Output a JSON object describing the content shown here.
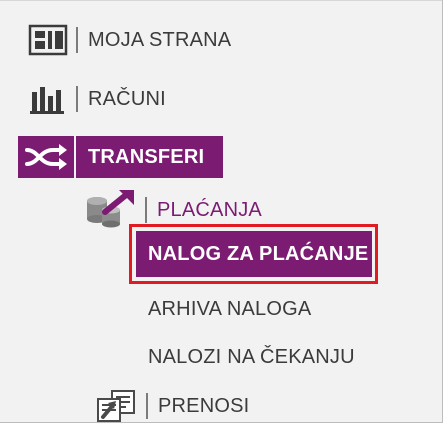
{
  "menu": {
    "items": [
      {
        "label": "MOJA STRANA",
        "icon": "dashboard-icon",
        "active": false
      },
      {
        "label": "RAČUNI",
        "icon": "bar-chart-icon",
        "active": false
      },
      {
        "label": "TRANSFERI",
        "icon": "shuffle-icon",
        "active": true
      }
    ],
    "submenu": {
      "header": {
        "label": "PLAĆANJA",
        "icon": "coins-arrow-icon"
      },
      "items": [
        {
          "label": "NALOG ZA PLAĆANJE",
          "selected": true
        },
        {
          "label": "ARHIVA NALOGA",
          "selected": false
        },
        {
          "label": "NALOZI NA ČEKANJU",
          "selected": false
        }
      ],
      "next_group": {
        "label": "PRENOSI",
        "icon": "documents-transfer-icon"
      }
    }
  },
  "colors": {
    "active_bg": "#7b1b72",
    "active_text": "#ffffff",
    "text": "#3b3b3b",
    "highlight_outline": "#e11b22",
    "background": "#f2f2f2"
  }
}
